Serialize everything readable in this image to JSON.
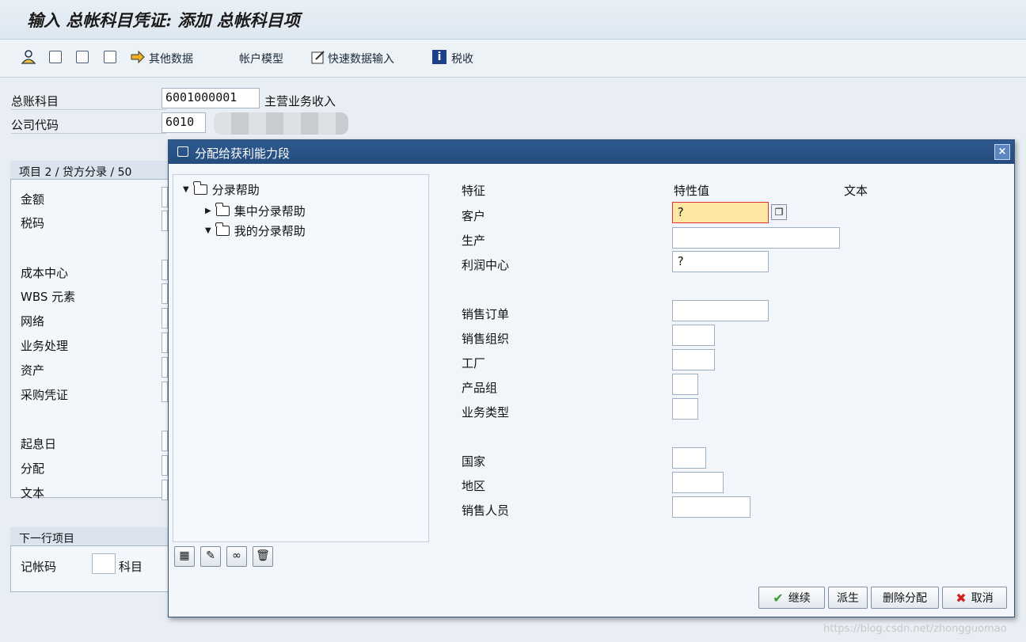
{
  "window": {
    "title": "输入 总帐科目凭证: 添加 总帐科目项"
  },
  "toolbar": {
    "other_data": "其他数据",
    "account_model": "帐户模型",
    "fast_entry": "快速数据输入",
    "tax": "税收"
  },
  "header_fields": {
    "gl_account_label": "总账科目",
    "gl_account_value": "6001000001",
    "gl_account_desc": "主营业务收入",
    "company_code_label": "公司代码",
    "company_code_value": "6010"
  },
  "item_group": {
    "title": "项目 2 / 贷方分录 / 50",
    "labels": [
      "金额",
      "税码",
      "成本中心",
      "WBS 元素",
      "网络",
      "业务处理",
      "资产",
      "采购凭证",
      "起息日",
      "分配",
      "文本"
    ]
  },
  "next_item_group": {
    "title": "下一行项目",
    "posting_key_label": "记帐码",
    "account_label": "科目"
  },
  "dialog": {
    "title": "分配给获利能力段",
    "close": "×",
    "tree": {
      "root": "分录帮助",
      "child1": "集中分录帮助",
      "child2": "我的分录帮助"
    },
    "columns": {
      "characteristic": "特征",
      "value": "特性值",
      "text": "文本"
    },
    "rows": [
      {
        "label": "客户",
        "value": "?"
      },
      {
        "label": "生产",
        "value": ""
      },
      {
        "label": "利润中心",
        "value": "?"
      },
      {
        "label": "销售订单",
        "value": ""
      },
      {
        "label": "销售组织",
        "value": ""
      },
      {
        "label": "工厂",
        "value": ""
      },
      {
        "label": "产品组",
        "value": ""
      },
      {
        "label": "业务类型",
        "value": ""
      },
      {
        "label": "国家",
        "value": ""
      },
      {
        "label": "地区",
        "value": ""
      },
      {
        "label": "销售人员",
        "value": ""
      }
    ],
    "buttons": {
      "continue": "继续",
      "derive": "派生",
      "delete_assignment": "删除分配",
      "cancel": "取消"
    }
  },
  "watermark": "https://blog.csdn.net/zhongguomao",
  "colors": {
    "dialog_title_bg": "#2e5a90",
    "focused_field_bg": "#fbe7a1",
    "continue_check": "#3a9a2a",
    "cancel_x": "#d02020"
  }
}
